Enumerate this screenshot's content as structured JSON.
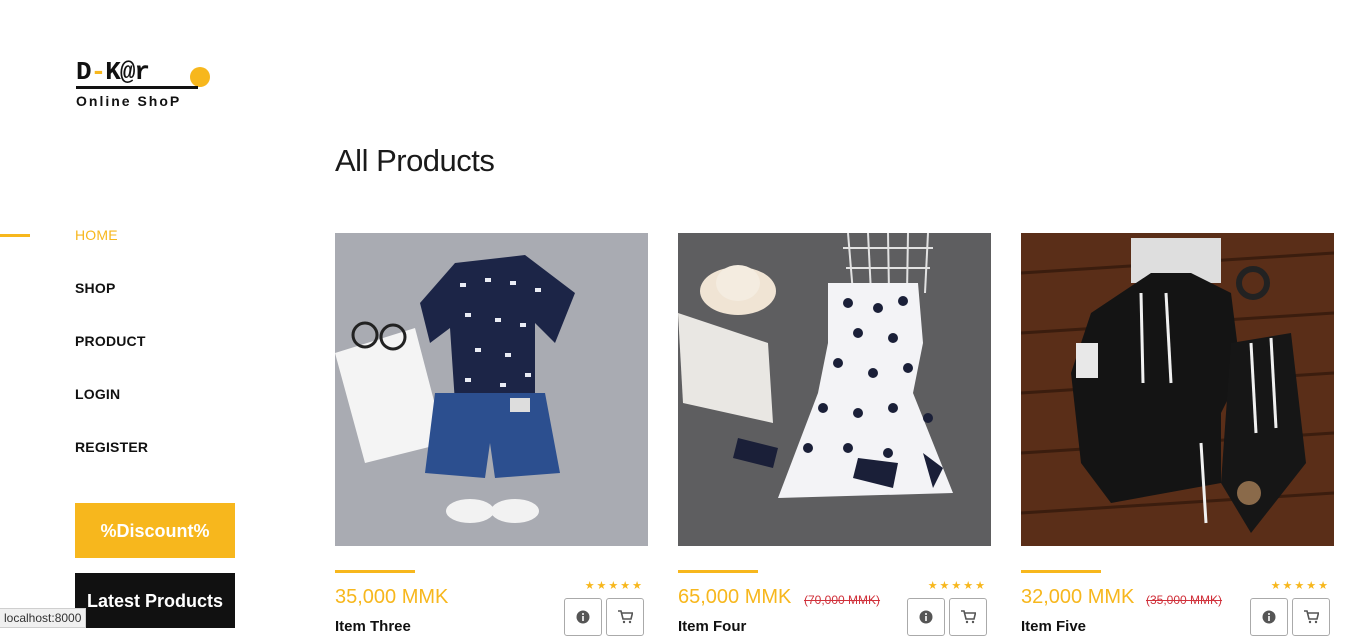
{
  "brand": {
    "line1_a": "D",
    "line1_b": "-",
    "line1_c": "K@r",
    "line2": "Online ShoP"
  },
  "nav": [
    {
      "label": "HOME",
      "active": true
    },
    {
      "label": "SHOP"
    },
    {
      "label": "PRODUCT"
    },
    {
      "label": "LOGIN"
    },
    {
      "label": "REGISTER"
    }
  ],
  "sidebar": {
    "discount_label": "%Discount%",
    "latest_label": "Latest Products"
  },
  "main": {
    "title": "All Products"
  },
  "products": [
    {
      "name": "Item Three",
      "price": "35,000 MMK",
      "old_price": "",
      "stars": "★★★★★"
    },
    {
      "name": "Item Four",
      "price": "65,000 MMK",
      "old_price": "(70,000 MMK)",
      "stars": "★★★★★"
    },
    {
      "name": "Item Five",
      "price": "32,000 MMK",
      "old_price": "(35,000 MMK)",
      "stars": "★★★★★"
    }
  ],
  "colors": {
    "accent": "#f7b71d",
    "dark": "#111111",
    "sale": "#d0303a"
  },
  "icons": {
    "info": "info-icon",
    "cart": "cart-icon"
  },
  "status": {
    "url": "localhost:8000"
  }
}
